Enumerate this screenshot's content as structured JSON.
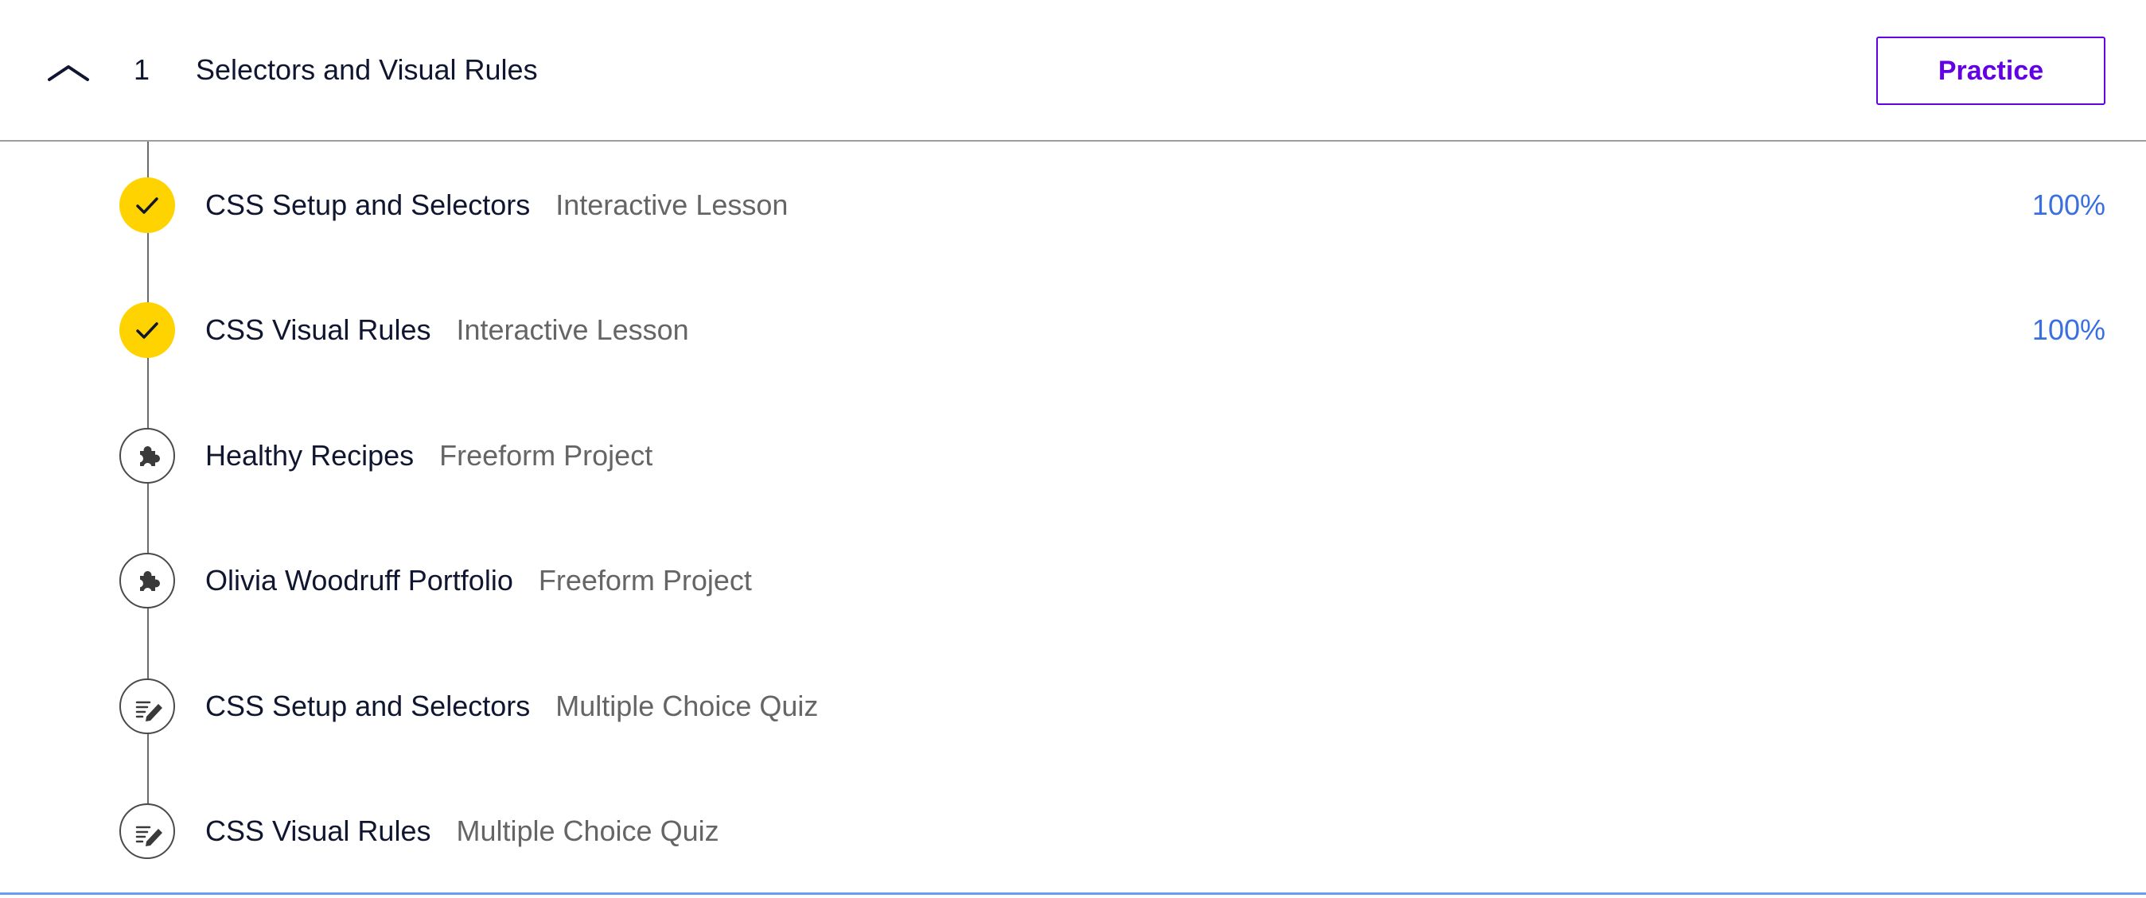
{
  "module": {
    "toggle_icon": "chevron-up-icon",
    "number": "1",
    "title": "Selectors and Visual Rules",
    "practice_label": "Practice",
    "accent_color": "#6400e4"
  },
  "items": [
    {
      "title": "CSS Setup and Selectors",
      "type": "Interactive Lesson",
      "progress": "100%",
      "status": "complete",
      "icon": "checkmark-icon"
    },
    {
      "title": "CSS Visual Rules",
      "type": "Interactive Lesson",
      "progress": "100%",
      "status": "complete",
      "icon": "checkmark-icon"
    },
    {
      "title": "Healthy Recipes",
      "type": "Freeform Project",
      "status": "not-started",
      "icon": "puzzle-piece-icon"
    },
    {
      "title": "Olivia Woodruff Portfolio",
      "type": "Freeform Project",
      "status": "not-started",
      "icon": "puzzle-piece-icon"
    },
    {
      "title": "CSS Setup and Selectors",
      "type": "Multiple Choice Quiz",
      "status": "not-started",
      "icon": "quiz-pencil-icon"
    },
    {
      "title": "CSS Visual Rules",
      "type": "Multiple Choice Quiz",
      "status": "not-started",
      "icon": "quiz-pencil-icon"
    }
  ],
  "colors": {
    "complete": "#ffd300",
    "progress_text": "#3a6fe0",
    "secondary_text": "#656565",
    "bottom_rule": "#6a9cf0"
  }
}
